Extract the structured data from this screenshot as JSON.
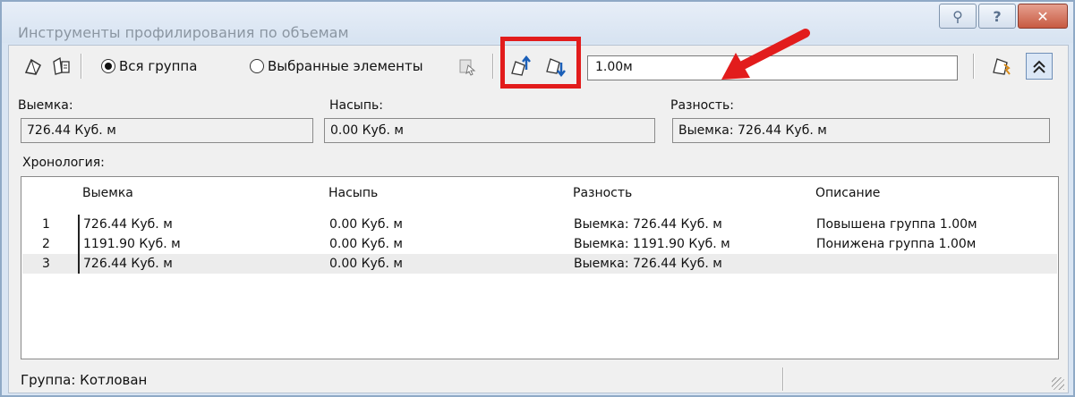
{
  "window": {
    "title": "Инструменты профилирования по объемам",
    "controls": [
      "help-search-icon",
      "help-icon",
      "close-icon"
    ]
  },
  "toolbar": {
    "scope_all_label": "Вся группа",
    "scope_selected_label": "Выбранные элементы",
    "scope_selected_value": "all",
    "step_value": "1.00м",
    "icons": [
      "select-surface-icon",
      "select-group-icon",
      "select-elements-icon",
      "raise-group-icon",
      "lower-group-icon",
      "report-icon",
      "collapse-icon"
    ]
  },
  "summary": {
    "cut_label": "Выемка:",
    "cut_value": "726.44 Куб. м",
    "fill_label": "Насыпь:",
    "fill_value": "0.00 Куб. м",
    "net_label": "Разность:",
    "net_value": "Выемка: 726.44 Куб. м"
  },
  "history": {
    "label": "Хронология:",
    "columns": [
      "Выемка",
      "Насыпь",
      "Разность",
      "Описание"
    ],
    "rows": [
      {
        "num": "1",
        "cut": "726.44 Куб. м",
        "fill": "0.00 Куб. м",
        "net": "Выемка: 726.44 Куб. м",
        "desc": "Повышена группа 1.00м"
      },
      {
        "num": "2",
        "cut": "1191.90 Куб. м",
        "fill": "0.00 Куб. м",
        "net": "Выемка: 1191.90 Куб. м",
        "desc": "Понижена группа 1.00м"
      },
      {
        "num": "3",
        "cut": "726.44 Куб. м",
        "fill": "0.00 Куб. м",
        "net": "Выемка: 726.44 Куб. м",
        "desc": ""
      }
    ]
  },
  "status": {
    "group_text": "Группа: Котлован"
  },
  "colors": {
    "highlight": "#e21c1c",
    "arrow": "#e21c1c",
    "close": "#c75a42"
  }
}
